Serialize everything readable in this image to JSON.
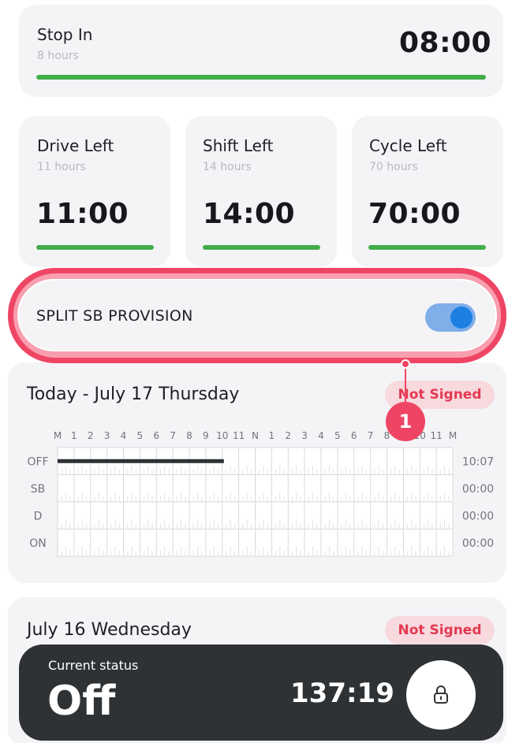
{
  "stop_in": {
    "title": "Stop In",
    "subtitle": "8 hours",
    "value": "08:00",
    "progress": 1.0
  },
  "counters": [
    {
      "title": "Drive Left",
      "subtitle": "11 hours",
      "value": "11:00",
      "progress": 1.0
    },
    {
      "title": "Shift Left",
      "subtitle": "14 hours",
      "value": "14:00",
      "progress": 1.0
    },
    {
      "title": "Cycle Left",
      "subtitle": "70 hours",
      "value": "70:00",
      "progress": 1.0
    }
  ],
  "split": {
    "label": "SPLIT SB PROVISION",
    "enabled": true
  },
  "callout": {
    "number": "1"
  },
  "today": {
    "title": "Today - July 17 Thursday",
    "badge": "Not Signed",
    "hour_labels": [
      "M",
      "1",
      "2",
      "3",
      "4",
      "5",
      "6",
      "7",
      "8",
      "9",
      "10",
      "11",
      "N",
      "1",
      "2",
      "3",
      "4",
      "5",
      "6",
      "7",
      "8",
      "9",
      "10",
      "11",
      "M"
    ],
    "rows": [
      {
        "label": "OFF",
        "total": "10:07"
      },
      {
        "label": "SB",
        "total": "00:00"
      },
      {
        "label": "D",
        "total": "00:00"
      },
      {
        "label": "ON",
        "total": "00:00"
      }
    ],
    "off_segment_hours": [
      0,
      10.1
    ]
  },
  "yesterday": {
    "title": "July 16 Wednesday",
    "badge": "Not Signed"
  },
  "status": {
    "caption": "Current status",
    "value": "Off",
    "time": "137:19"
  },
  "colors": {
    "accent_green": "#44ad4b",
    "alert_red": "#ef4565",
    "toggle_blue": "#1c7fe2",
    "dark": "#2f3235"
  }
}
